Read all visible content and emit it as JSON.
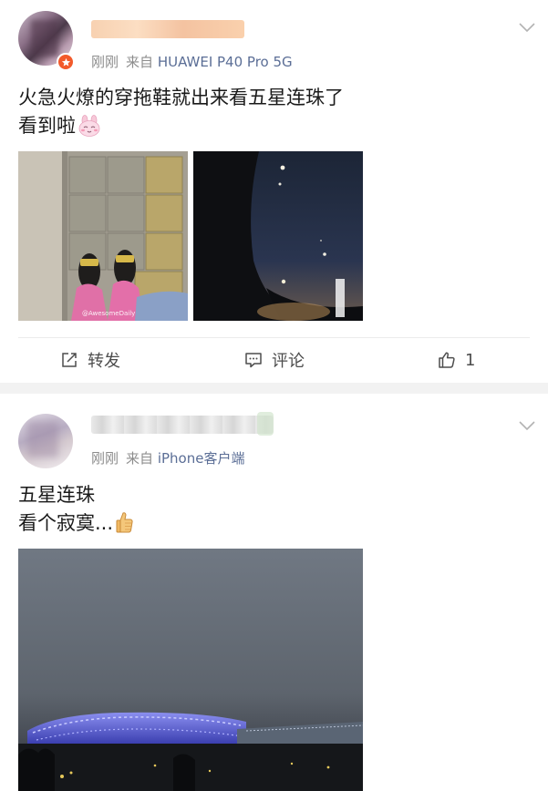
{
  "posts": [
    {
      "time": "刚刚",
      "source_prefix": "来自",
      "source": "HUAWEI P40 Pro 5G",
      "text_line1": "火急火燎的穿拖鞋就出来看五星连珠了",
      "text_line2": "看到啦",
      "image1_watermark": "@AwesomeDaily",
      "actions": {
        "repost_label": "转发",
        "comment_label": "评论",
        "like_count": "1"
      }
    },
    {
      "time": "刚刚",
      "source_prefix": "来自",
      "source": "iPhone客户端",
      "text_line1": "五星连珠",
      "text_line2": "看个寂寞..."
    }
  ],
  "colors": {
    "accent_link": "#5b6e96",
    "badge_orange": "#f25a2b",
    "meta_gray": "#8c8c8c",
    "section_gap": "#f2f2f2"
  },
  "icons": {
    "expand": "chevron-down-icon",
    "repost": "repost-icon",
    "comment": "comment-icon",
    "like": "thumbs-up-icon",
    "verified": "verified-badge-icon",
    "emoji1": "rabbit-emoji-icon",
    "emoji2": "thumbs-up-emoji-icon"
  }
}
